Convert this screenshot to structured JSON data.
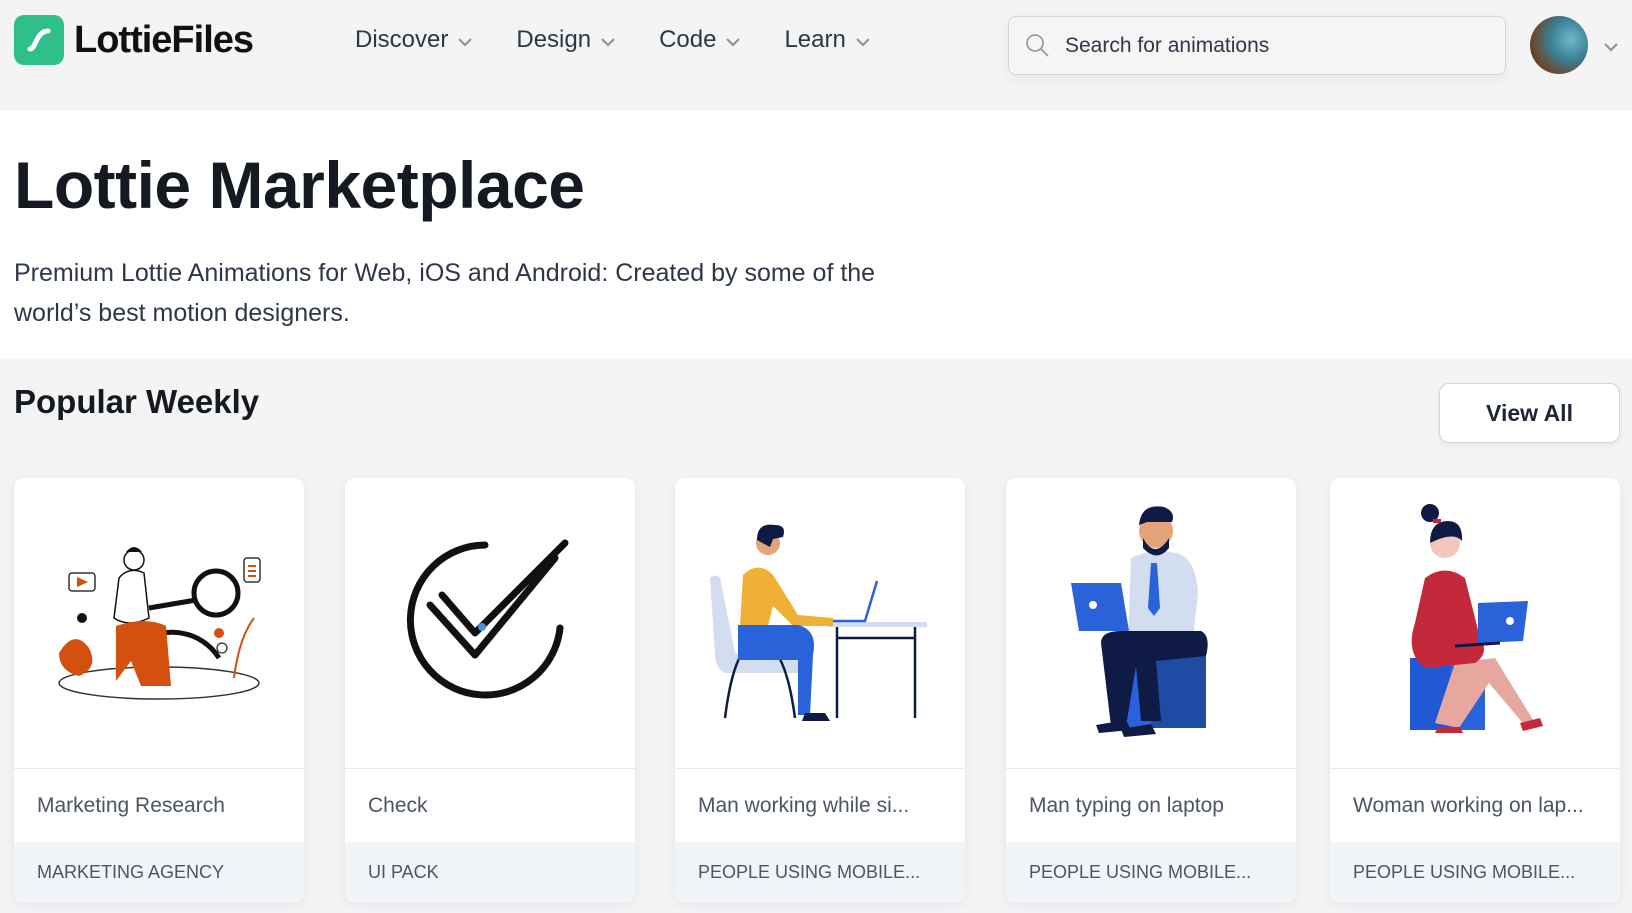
{
  "header": {
    "logo_text": "LottieFiles",
    "nav": [
      {
        "label": "Discover"
      },
      {
        "label": "Design"
      },
      {
        "label": "Code"
      },
      {
        "label": "Learn"
      }
    ],
    "search": {
      "placeholder": "Search for animations",
      "value": ""
    },
    "brand_color": "#2fbf8a"
  },
  "hero": {
    "title": "Lottie Marketplace",
    "description": "Premium Lottie Animations for Web, iOS and Android: Created by some of the world’s best motion designers."
  },
  "popular": {
    "title": "Popular Weekly",
    "view_all_label": "View All",
    "cards": [
      {
        "name": "Marketing Research",
        "pack": "MARKETING AGENCY",
        "illustration": "marketing-research-illustration"
      },
      {
        "name": "Check",
        "pack": "UI PACK",
        "illustration": "check-illustration"
      },
      {
        "name": "Man working while si...",
        "pack": "PEOPLE USING MOBILE...",
        "illustration": "man-at-desk-illustration"
      },
      {
        "name": "Man typing on laptop",
        "pack": "PEOPLE USING MOBILE...",
        "illustration": "man-laptop-illustration"
      },
      {
        "name": "Woman working on lap...",
        "pack": "PEOPLE USING MOBILE...",
        "illustration": "woman-laptop-illustration"
      }
    ]
  }
}
